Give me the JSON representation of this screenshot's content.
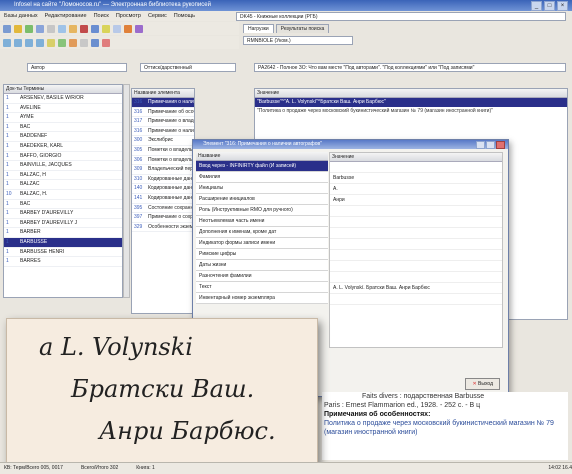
{
  "window": {
    "title": "Infosel на сайте \"Ломоносов.ru\" — Электронная библиотека рукописей"
  },
  "menu": [
    "Базы данных",
    "Редактирование",
    "Поиск",
    "Просмотр",
    "Сервис",
    "Помощь"
  ],
  "search_combo_value": "DK45 - Книжные коллекции (РГБ)",
  "tabs": [
    "Нагрузки",
    "Результаты поиска"
  ],
  "left_combo_value": "Автор",
  "mid_combo_value": "Оттиск/дарственный",
  "filter_combo_value": "РА2642 - Полное ЗО: Что вам месте \"Под авторами\". \"Под коллекциями\" или \"Под записями\"",
  "list": {
    "header_num": "Док-ты",
    "header_name": "Термины",
    "rows": [
      {
        "n": "1",
        "t": "ARSENEV, BASILE W/R/OR"
      },
      {
        "n": "1",
        "t": "AVELINE"
      },
      {
        "n": "1",
        "t": "AYME"
      },
      {
        "n": "1",
        "t": "BAC"
      },
      {
        "n": "1",
        "t": "BADDENEF"
      },
      {
        "n": "1",
        "t": "BAEDEKER, KARL"
      },
      {
        "n": "1",
        "t": "BAFFO, GIORGIO"
      },
      {
        "n": "1",
        "t": "BAINVILLE, JACQUES"
      },
      {
        "n": "1",
        "t": "BALZAC, H"
      },
      {
        "n": "1",
        "t": "BALZAC"
      },
      {
        "n": "10",
        "t": "BALZAC, H."
      },
      {
        "n": "1",
        "t": "BAC"
      },
      {
        "n": "1",
        "t": "BARBEY D'AUREVILLY"
      },
      {
        "n": "1",
        "t": "BARBEY D'AUREVILLY J"
      },
      {
        "n": "1",
        "t": "BARBER"
      },
      {
        "n": "1",
        "t": "BARBUSSE"
      },
      {
        "n": "1",
        "t": "BARBUSSE HENRI"
      },
      {
        "n": "1",
        "t": "BARRES"
      }
    ],
    "selected_index": 15
  },
  "fields": {
    "header": "Название элемента",
    "rows": [
      {
        "n": "316",
        "t": "Примечания о наличии автографов"
      },
      {
        "n": "316",
        "t": "Примечание об особенностях экземпляра"
      },
      {
        "n": "317",
        "t": "Примечание о владельческих пометках"
      },
      {
        "n": "316",
        "t": "Примечание о наличии автографов"
      },
      {
        "n": "300",
        "t": "Экслибрис"
      },
      {
        "n": "305",
        "t": "Пометки о владельце"
      },
      {
        "n": "306",
        "t": "Пометки о владельце"
      },
      {
        "n": "309",
        "t": "Владельческий переплёт"
      },
      {
        "n": "310",
        "t": "Кодированные данные"
      },
      {
        "n": "140",
        "t": "Кодированные данные"
      },
      {
        "n": "141",
        "t": "Кодированные данные"
      },
      {
        "n": "395",
        "t": "Состояние сохранности"
      },
      {
        "n": "397",
        "t": "Примечание о сохранности"
      },
      {
        "n": "329",
        "t": "Особенности экземпляра"
      }
    ],
    "selected_index": 0
  },
  "value_panel": {
    "header": "Значение",
    "highlight": "\"Barbusse\"^\"A. L. Volynskí\"^Братски Ваш. Анри Барбюс\"",
    "line2": "\"Политика о продаже через московский букинистический магазин № 79 (магазин иностранной книги)\""
  },
  "dialog": {
    "title": "Элемент \"316: Примечания о наличии автографов\"",
    "col1": "Название",
    "col2": "Значение",
    "rows": [
      {
        "name": "Ввод через - INFINIRTY файл (И записей)",
        "val": ""
      },
      {
        "name": "Фамилия",
        "val": "Barbusse"
      },
      {
        "name": "Инициалы",
        "val": "A."
      },
      {
        "name": "Расширение инициалов",
        "val": "Анри"
      },
      {
        "name": "Роль (Инструктивные RMO для ручного)",
        "val": ""
      },
      {
        "name": "Неотъемлемая часть имени",
        "val": ""
      },
      {
        "name": "Дополнения к именам, кроме дат",
        "val": ""
      },
      {
        "name": "Индикатор формы записи имени",
        "val": ""
      },
      {
        "name": "Римские цифры",
        "val": ""
      },
      {
        "name": "Даты жизни",
        "val": ""
      },
      {
        "name": "Разночтения фамилии",
        "val": ""
      },
      {
        "name": "Текст",
        "val": "A. L. Volynskí. Братски Ваш. Анри Барбюс"
      },
      {
        "name": "Инвентарный номер экземпляра",
        "val": ""
      }
    ],
    "ok_label": "Выход"
  },
  "bottom_text": {
    "line1": "Faits divers : подарственная Barbusse",
    "line2": "Paris : Ernest Flammarion ed., 1928. - 252 с. - В ц",
    "heading": "Примечания об особенностях:",
    "body": "Политика о продаже через московский букинистический магазин № 79 (магазин иностранной книги)"
  },
  "autograph": {
    "line1": "a  L. Volynski",
    "line2": "Братски  Ваш.",
    "line3": "Анри Барбюс."
  },
  "status": [
    "КВ: Терм/Всего 005, 0017",
    "Всего/Итого 302",
    "Книга: 1",
    "14:02 16.4"
  ]
}
